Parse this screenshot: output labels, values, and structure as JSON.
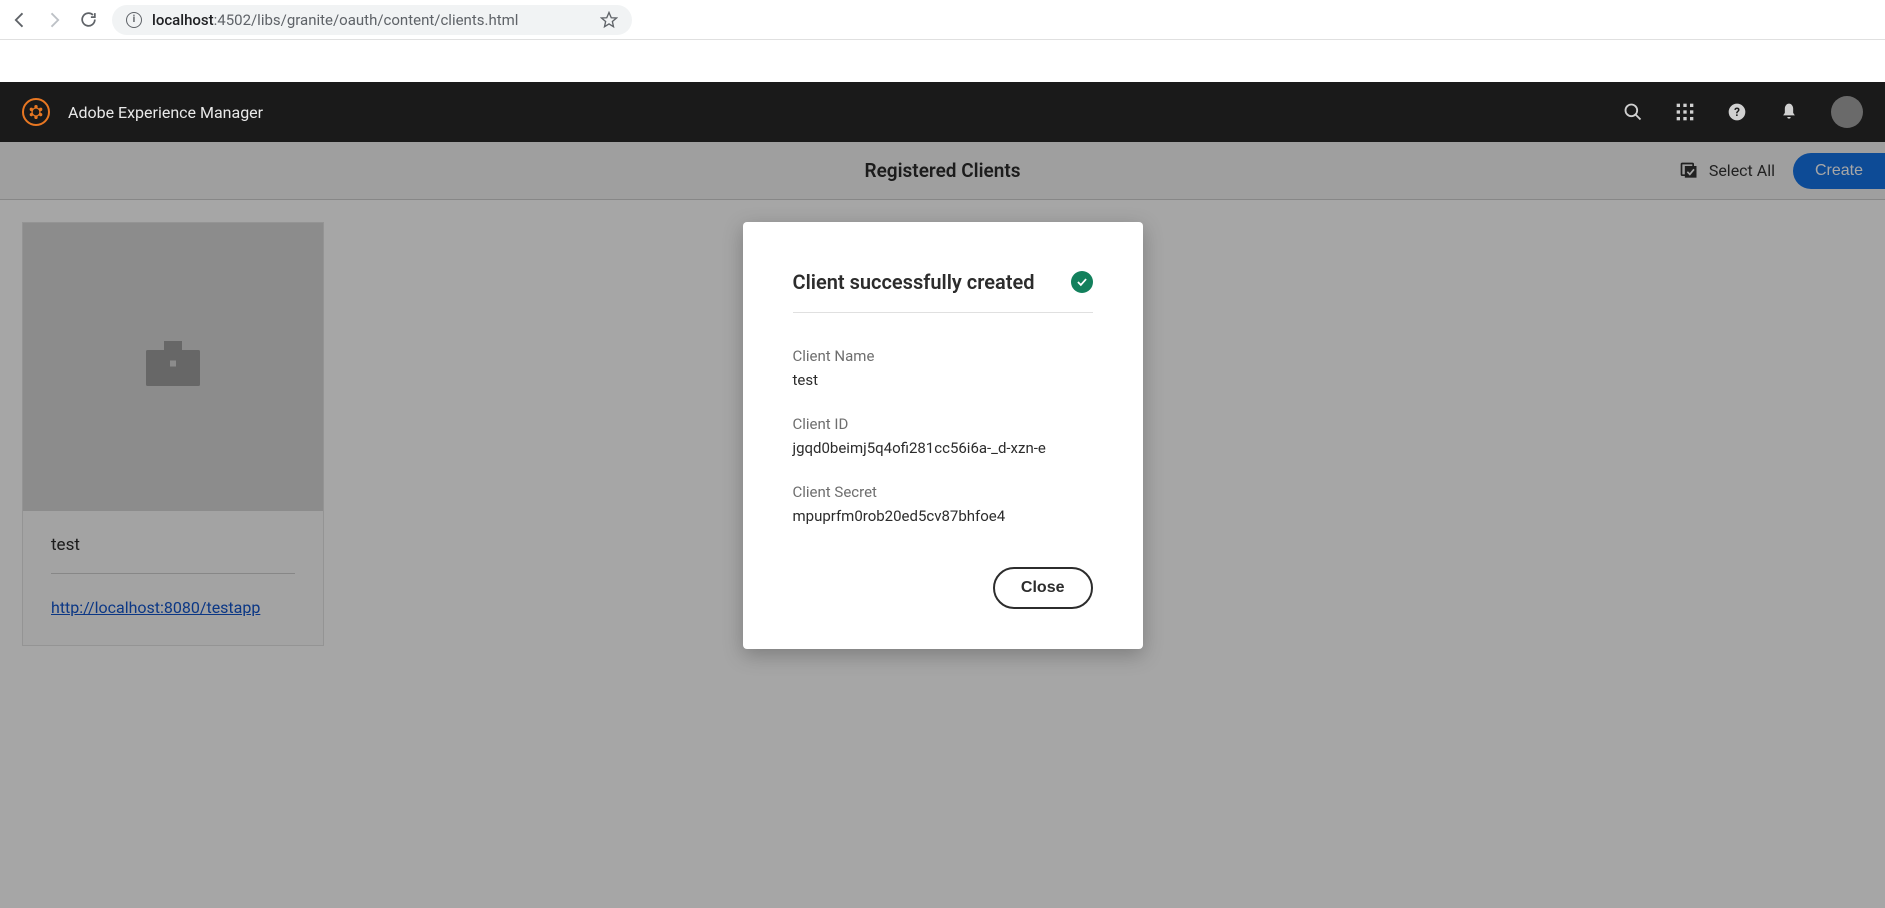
{
  "browser": {
    "url_host": "localhost",
    "url_port_path": ":4502/libs/granite/oauth/content/clients.html"
  },
  "aem": {
    "product_name": "Adobe Experience Manager"
  },
  "action_bar": {
    "title": "Registered Clients",
    "select_all_label": "Select All",
    "create_label": "Create"
  },
  "card": {
    "name": "test",
    "redirect_uri": "http://localhost:8080/testapp"
  },
  "dialog": {
    "title": "Client successfully created",
    "fields": {
      "name_label": "Client Name",
      "name_value": "test",
      "id_label": "Client ID",
      "id_value": "jgqd0beimj5q4ofi281cc56i6a-_d-xzn-e",
      "secret_label": "Client Secret",
      "secret_value": "mpuprfm0rob20ed5cv87bhfoe4"
    },
    "close_label": "Close"
  }
}
